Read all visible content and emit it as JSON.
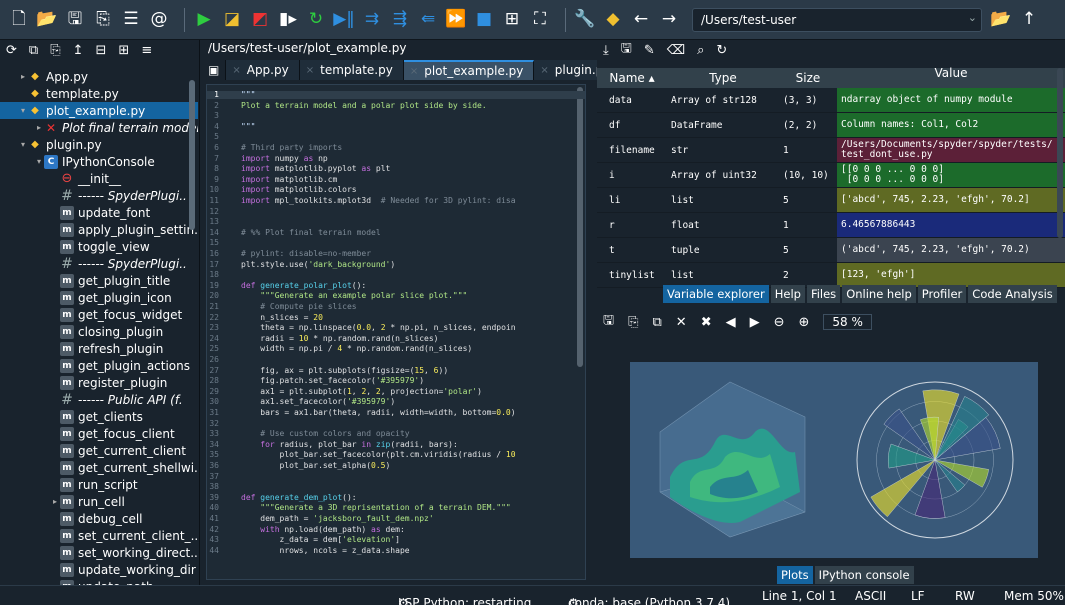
{
  "toolbar": {
    "icons": [
      "new-file-icon",
      "open-folder-icon",
      "save-icon",
      "save-all-icon",
      "list-icon",
      "at-icon",
      "run-icon",
      "run-cell-icon",
      "run-cell-advance-icon",
      "run-selection-icon",
      "rerun-icon",
      "debug-icon",
      "step-icon",
      "step-into-icon",
      "step-out-icon",
      "continue-icon",
      "stop-icon",
      "maximize-icon",
      "fullscreen-icon",
      "wrench-icon",
      "python-path-icon",
      "back-icon",
      "forward-icon"
    ],
    "path": "/Users/test-user"
  },
  "explorer": {
    "tools": [
      "refresh-icon",
      "copy-icon",
      "paste-icon",
      "upload-icon",
      "collapse-icon",
      "expand-icon",
      "menu-icon"
    ],
    "tree": [
      {
        "label": "App.py",
        "icon": "py",
        "indent": 0,
        "arrow": "▸",
        "italic": false
      },
      {
        "label": "template.py",
        "icon": "py",
        "indent": 0,
        "arrow": "",
        "italic": false
      },
      {
        "label": "plot_example.py",
        "icon": "py",
        "indent": 0,
        "arrow": "▾",
        "italic": false,
        "selected": true
      },
      {
        "label": "Plot final terrain model",
        "icon": "x",
        "indent": 1,
        "arrow": "▸",
        "italic": true
      },
      {
        "label": "plugin.py",
        "icon": "py",
        "indent": 0,
        "arrow": "▾",
        "italic": false
      },
      {
        "label": "IPythonConsole",
        "icon": "c",
        "indent": 1,
        "arrow": "▾",
        "italic": false
      },
      {
        "label": "__init__",
        "icon": "f",
        "indent": 2,
        "arrow": "",
        "italic": false
      },
      {
        "label": "------ SpyderPlugi..",
        "icon": "h",
        "indent": 2,
        "arrow": "",
        "italic": true
      },
      {
        "label": "update_font",
        "icon": "m",
        "indent": 2,
        "arrow": "",
        "italic": false
      },
      {
        "label": "apply_plugin_settin..",
        "icon": "m",
        "indent": 2,
        "arrow": "",
        "italic": false
      },
      {
        "label": "toggle_view",
        "icon": "m",
        "indent": 2,
        "arrow": "",
        "italic": false
      },
      {
        "label": "------ SpyderPlugi..",
        "icon": "h",
        "indent": 2,
        "arrow": "",
        "italic": true
      },
      {
        "label": "get_plugin_title",
        "icon": "m",
        "indent": 2,
        "arrow": "",
        "italic": false
      },
      {
        "label": "get_plugin_icon",
        "icon": "m",
        "indent": 2,
        "arrow": "",
        "italic": false
      },
      {
        "label": "get_focus_widget",
        "icon": "m",
        "indent": 2,
        "arrow": "",
        "italic": false
      },
      {
        "label": "closing_plugin",
        "icon": "m",
        "indent": 2,
        "arrow": "",
        "italic": false
      },
      {
        "label": "refresh_plugin",
        "icon": "m",
        "indent": 2,
        "arrow": "",
        "italic": false
      },
      {
        "label": "get_plugin_actions",
        "icon": "m",
        "indent": 2,
        "arrow": "",
        "italic": false
      },
      {
        "label": "register_plugin",
        "icon": "m",
        "indent": 2,
        "arrow": "",
        "italic": false
      },
      {
        "label": "------ Public API (f.",
        "icon": "h",
        "indent": 2,
        "arrow": "",
        "italic": true
      },
      {
        "label": "get_clients",
        "icon": "m",
        "indent": 2,
        "arrow": "",
        "italic": false
      },
      {
        "label": "get_focus_client",
        "icon": "m",
        "indent": 2,
        "arrow": "",
        "italic": false
      },
      {
        "label": "get_current_client",
        "icon": "m",
        "indent": 2,
        "arrow": "",
        "italic": false
      },
      {
        "label": "get_current_shellwi.",
        "icon": "m",
        "indent": 2,
        "arrow": "",
        "italic": false
      },
      {
        "label": "run_script",
        "icon": "m",
        "indent": 2,
        "arrow": "",
        "italic": false
      },
      {
        "label": "run_cell",
        "icon": "m",
        "indent": 2,
        "arrow": "▸",
        "italic": false
      },
      {
        "label": "debug_cell",
        "icon": "m",
        "indent": 2,
        "arrow": "",
        "italic": false
      },
      {
        "label": "set_current_client_..",
        "icon": "m",
        "indent": 2,
        "arrow": "",
        "italic": false
      },
      {
        "label": "set_working_direct..",
        "icon": "m",
        "indent": 2,
        "arrow": "",
        "italic": false
      },
      {
        "label": "update_working_dir",
        "icon": "m",
        "indent": 2,
        "arrow": "",
        "italic": false
      },
      {
        "label": "update_path",
        "icon": "m",
        "indent": 2,
        "arrow": "",
        "italic": false
      }
    ]
  },
  "editor": {
    "path": "/Users/test-user/plot_example.py",
    "tabs": [
      "App.py",
      "template.py",
      "plot_example.py",
      "plugin.py"
    ],
    "active_tab": 2,
    "current_line": 1,
    "lines": [
      [
        [
          "d",
          "\"\"\""
        ]
      ],
      [
        [
          "s",
          "Plot a terrain model and a polar plot side by side."
        ]
      ],
      [],
      [
        [
          "d",
          "\"\"\""
        ]
      ],
      [],
      [
        [
          "c",
          "# Third party imports"
        ]
      ],
      [
        [
          "k",
          "import"
        ],
        [
          "t",
          " numpy "
        ],
        [
          "k",
          "as"
        ],
        [
          "t",
          " np"
        ]
      ],
      [
        [
          "k",
          "import"
        ],
        [
          "t",
          " matplotlib.pyplot "
        ],
        [
          "k",
          "as"
        ],
        [
          "t",
          " plt"
        ]
      ],
      [
        [
          "k",
          "import"
        ],
        [
          "t",
          " matplotlib.cm"
        ]
      ],
      [
        [
          "k",
          "import"
        ],
        [
          "t",
          " matplotlib.colors"
        ]
      ],
      [
        [
          "k",
          "import"
        ],
        [
          "t",
          " mpl_toolkits.mplot3d  "
        ],
        [
          "c",
          "# Needed for 3D pylint: disa"
        ]
      ],
      [],
      [],
      [
        [
          "c",
          "# %% Plot final terrain model"
        ]
      ],
      [],
      [
        [
          "c",
          "# pylint: disable=no-member"
        ]
      ],
      [
        [
          "t",
          "plt.style.use("
        ],
        [
          "s",
          "'dark_background'"
        ],
        [
          "t",
          ")"
        ]
      ],
      [],
      [
        [
          "k",
          "def"
        ],
        [
          "t",
          " "
        ],
        [
          "f",
          "generate_polar_plot"
        ],
        [
          "t",
          "():"
        ]
      ],
      [
        [
          "t",
          "    "
        ],
        [
          "s",
          "\"\"\"Generate an example polar slice plot.\"\"\""
        ]
      ],
      [
        [
          "t",
          "    "
        ],
        [
          "c",
          "# Compute pie slices"
        ]
      ],
      [
        [
          "t",
          "    n_slices = "
        ],
        [
          "num",
          "20"
        ]
      ],
      [
        [
          "t",
          "    theta = np.linspace("
        ],
        [
          "num",
          "0.0"
        ],
        [
          "t",
          ", "
        ],
        [
          "num",
          "2"
        ],
        [
          "t",
          " * np.pi, n_slices, endpoin"
        ]
      ],
      [
        [
          "t",
          "    radii = "
        ],
        [
          "num",
          "10"
        ],
        [
          "t",
          " * np.random.rand(n_slices)"
        ]
      ],
      [
        [
          "t",
          "    width = np.pi / "
        ],
        [
          "num",
          "4"
        ],
        [
          "t",
          " * np.random.rand(n_slices)"
        ]
      ],
      [],
      [
        [
          "t",
          "    fig, ax = plt.subplots(figsize=("
        ],
        [
          "num",
          "15"
        ],
        [
          "t",
          ", "
        ],
        [
          "num",
          "6"
        ],
        [
          "t",
          "))"
        ]
      ],
      [
        [
          "t",
          "    fig.patch.set_facecolor("
        ],
        [
          "s",
          "'#395979'"
        ],
        [
          "t",
          ")"
        ]
      ],
      [
        [
          "t",
          "    ax1 = plt.subplot("
        ],
        [
          "num",
          "1"
        ],
        [
          "t",
          ", "
        ],
        [
          "num",
          "2"
        ],
        [
          "t",
          ", "
        ],
        [
          "num",
          "2"
        ],
        [
          "t",
          ", projection="
        ],
        [
          "s",
          "'polar'"
        ],
        [
          "t",
          ")"
        ]
      ],
      [
        [
          "t",
          "    ax1.set_facecolor("
        ],
        [
          "s",
          "'#395979'"
        ],
        [
          "t",
          ")"
        ]
      ],
      [
        [
          "t",
          "    bars = ax1.bar(theta, radii, width=width, bottom="
        ],
        [
          "num",
          "0.0"
        ],
        [
          "t",
          ")"
        ]
      ],
      [],
      [
        [
          "t",
          "    "
        ],
        [
          "c",
          "# Use custom colors and opacity"
        ]
      ],
      [
        [
          "t",
          "    "
        ],
        [
          "k",
          "for"
        ],
        [
          "t",
          " radius, plot_bar "
        ],
        [
          "k",
          "in"
        ],
        [
          "t",
          " "
        ],
        [
          "f",
          "zip"
        ],
        [
          "t",
          "(radii, bars):"
        ]
      ],
      [
        [
          "t",
          "        plot_bar.set_facecolor(plt.cm.viridis(radius / "
        ],
        [
          "num",
          "10"
        ]
      ],
      [
        [
          "t",
          "        plot_bar.set_alpha("
        ],
        [
          "num",
          "0.5"
        ],
        [
          "t",
          ")"
        ]
      ],
      [],
      [],
      [
        [
          "k",
          "def"
        ],
        [
          "t",
          " "
        ],
        [
          "f",
          "generate_dem_plot"
        ],
        [
          "t",
          "():"
        ]
      ],
      [
        [
          "t",
          "    "
        ],
        [
          "s",
          "\"\"\"Generate a 3D reprisentation of a terrain DEM.\"\"\""
        ]
      ],
      [
        [
          "t",
          "    dem_path = "
        ],
        [
          "s",
          "'jacksboro_fault_dem.npz'"
        ]
      ],
      [
        [
          "t",
          "    "
        ],
        [
          "k",
          "with"
        ],
        [
          "t",
          " np.load(dem_path) "
        ],
        [
          "k",
          "as"
        ],
        [
          "t",
          " dem:"
        ]
      ],
      [
        [
          "t",
          "        z_data = dem["
        ],
        [
          "s",
          "'elevation'"
        ],
        [
          "t",
          "]"
        ]
      ],
      [
        [
          "t",
          "        nrows, ncols = z_data.shape"
        ]
      ]
    ]
  },
  "variables": {
    "tools": [
      "import-icon",
      "save-icon",
      "save-as-icon",
      "erase-icon",
      "search-icon",
      "refresh-icon"
    ],
    "headers": [
      "Name",
      "Type",
      "Size",
      "Value"
    ],
    "rows": [
      {
        "name": "data",
        "type": "Array of str128",
        "size": "(3, 3)",
        "value": "ndarray object of numpy module",
        "color": "#1c6b2b"
      },
      {
        "name": "df",
        "type": "DataFrame",
        "size": "(2, 2)",
        "value": "Column names: Col1, Col2",
        "color": "#1c6b2b"
      },
      {
        "name": "filename",
        "type": "str",
        "size": "1",
        "value": "/Users/Documents/spyder/spyder/tests/\ntest_dont_use.py",
        "color": "#5c2038"
      },
      {
        "name": "i",
        "type": "Array of uint32",
        "size": "(10, 10)",
        "value": "[[0 0 0 ... 0 0 0]\n [0 0 0 ... 0 0 0]",
        "color": "#1c6b2b"
      },
      {
        "name": "li",
        "type": "list",
        "size": "5",
        "value": "['abcd', 745, 2.23, 'efgh', 70.2]",
        "color": "#5f6a23"
      },
      {
        "name": "r",
        "type": "float",
        "size": "1",
        "value": "6.46567886443",
        "color": "#1a2a7a"
      },
      {
        "name": "t",
        "type": "tuple",
        "size": "5",
        "value": "('abcd', 745, 2.23, 'efgh', 70.2)",
        "color": "#3b4450"
      },
      {
        "name": "tinylist",
        "type": "list",
        "size": "2",
        "value": "[123, 'efgh']",
        "color": "#5f6a23"
      }
    ],
    "tabs": [
      "Variable explorer",
      "Help",
      "Files",
      "Online help",
      "Profiler",
      "Code Analysis"
    ],
    "active_tab": 0
  },
  "plots": {
    "tools": [
      "save-icon",
      "save-all-icon",
      "copy-icon",
      "close-icon",
      "close-all-icon",
      "previous-icon",
      "next-icon",
      "zoom-out-icon",
      "zoom-in-icon"
    ],
    "zoom": "58 %",
    "tabs": [
      "Plots",
      "IPython console"
    ],
    "active_tab": 0,
    "figure_bg": "#395979",
    "polar_bar_colors": [
      "#f5e626",
      "#1f9e89",
      "#3b528b",
      "#b5de2b",
      "#26828e",
      "#482878"
    ]
  },
  "status": {
    "lsp": "LSP Python: restarting...",
    "conda": "conda: base (Python 3.7.4)",
    "position": "Line 1, Col 1",
    "encoding": "ASCII",
    "eol": "LF",
    "mode": "RW",
    "mem": "Mem 50%"
  }
}
